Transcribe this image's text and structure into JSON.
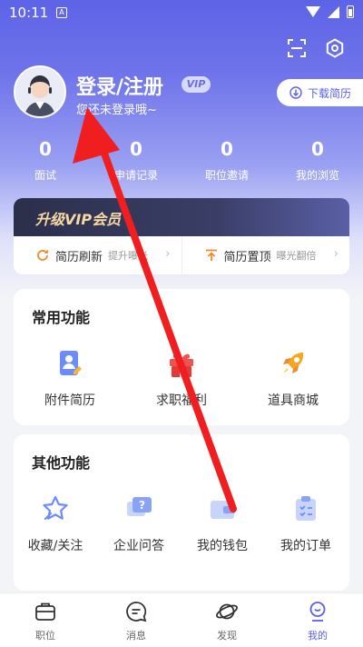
{
  "status_bar": {
    "time": "10:11",
    "badge": "A"
  },
  "profile": {
    "title": "登录/注册",
    "vip_tag": "VIP",
    "subtitle": "您还未登录哦~",
    "download_label": "下载简历"
  },
  "stats": [
    {
      "value": "0",
      "label": "面试"
    },
    {
      "value": "0",
      "label": "申请记录"
    },
    {
      "value": "0",
      "label": "职位邀请"
    },
    {
      "value": "0",
      "label": "我的浏览"
    }
  ],
  "vip": {
    "banner": "升级VIP会员",
    "actions": [
      {
        "name": "简历刷新",
        "hint": "提升曝光"
      },
      {
        "name": "简历置顶",
        "hint": "曝光翻倍"
      }
    ]
  },
  "common": {
    "title": "常用功能",
    "items": [
      "附件简历",
      "求职福利",
      "道具商城"
    ]
  },
  "other": {
    "title": "其他功能",
    "items": [
      "收藏/关注",
      "企业问答",
      "我的钱包",
      "我的订单"
    ]
  },
  "tabs": [
    {
      "label": "职位",
      "icon": "briefcase-icon"
    },
    {
      "label": "消息",
      "icon": "chat-icon"
    },
    {
      "label": "发现",
      "icon": "planet-icon"
    },
    {
      "label": "我的",
      "icon": "profile-icon"
    }
  ],
  "colors": {
    "primary": "#5b60e6",
    "vip_gold": "#f6d9a3",
    "annotation": "#f01e1e"
  }
}
